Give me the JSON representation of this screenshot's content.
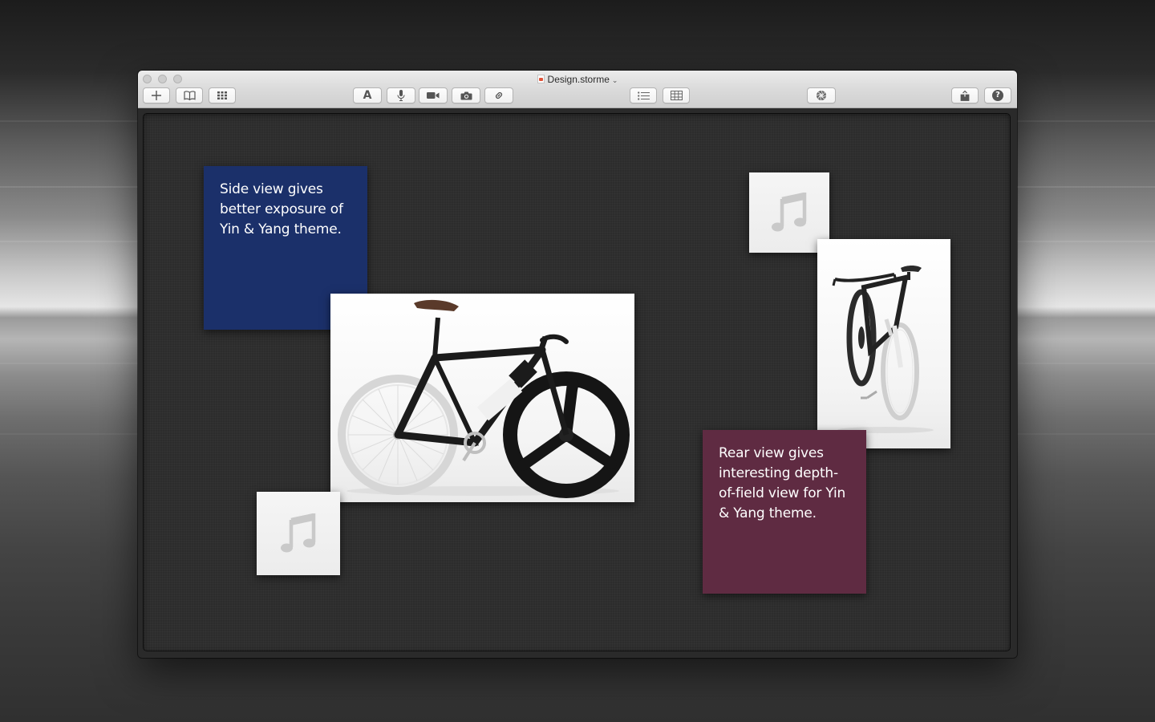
{
  "window": {
    "title": "Design.storme",
    "title_chevron": "⌄"
  },
  "toolbar": {
    "left": [
      {
        "name": "add-button",
        "icon": "plus-icon"
      },
      {
        "name": "library-button",
        "icon": "book-icon"
      },
      {
        "name": "grid-view-button",
        "icon": "grid-icon"
      }
    ],
    "insert": [
      {
        "name": "add-text-button",
        "icon": "text-icon",
        "label": "A"
      },
      {
        "name": "record-audio-button",
        "icon": "microphone-icon"
      },
      {
        "name": "record-video-button",
        "icon": "video-camera-icon"
      },
      {
        "name": "take-photo-button",
        "icon": "camera-icon"
      },
      {
        "name": "add-link-button",
        "icon": "link-icon"
      }
    ],
    "view": [
      {
        "name": "list-view-button",
        "icon": "list-icon"
      },
      {
        "name": "table-view-button",
        "icon": "table-icon"
      }
    ],
    "center": [
      {
        "name": "theme-button",
        "icon": "aperture-icon"
      }
    ],
    "right": [
      {
        "name": "share-button",
        "icon": "share-icon"
      },
      {
        "name": "help-button",
        "icon": "help-icon",
        "label": "?"
      }
    ]
  },
  "board": {
    "notes": [
      {
        "name": "note-side-view",
        "text": "Side view gives better exposure of Yin & Yang theme.",
        "color": "#1b306a"
      },
      {
        "name": "note-rear-view",
        "text": "Rear view gives interesting depth-of-field view for Yin & Yang theme.",
        "color": "#5f2b42"
      }
    ],
    "audio_cards": [
      {
        "name": "audio-card-top",
        "icon": "music-note-icon"
      },
      {
        "name": "audio-card-bottom",
        "icon": "music-note-icon"
      }
    ],
    "photos": [
      {
        "name": "photo-bike-side",
        "subject": "bicycle-side-view"
      },
      {
        "name": "photo-bike-rear",
        "subject": "bicycle-rear-view"
      }
    ]
  },
  "colors": {
    "canvas": "#2c2c2c",
    "note_blue": "#1b306a",
    "note_plum": "#5f2b42",
    "card_light": "#f0f0f0"
  }
}
